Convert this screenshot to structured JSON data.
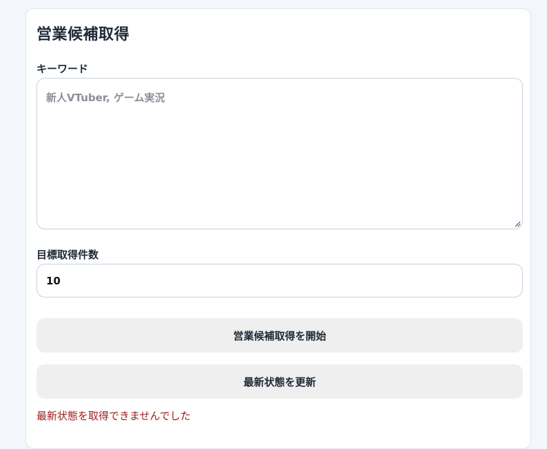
{
  "form": {
    "title": "営業候補取得",
    "keyword_label": "キーワード",
    "keyword_placeholder": "新人VTuber, ゲーム実況",
    "keyword_value": "",
    "target_label": "目標取得件数",
    "target_value": "10"
  },
  "actions": {
    "start_label": "営業候補取得を開始",
    "refresh_label": "最新状態を更新"
  },
  "status": {
    "error_message": "最新状態を取得できませんでした"
  }
}
